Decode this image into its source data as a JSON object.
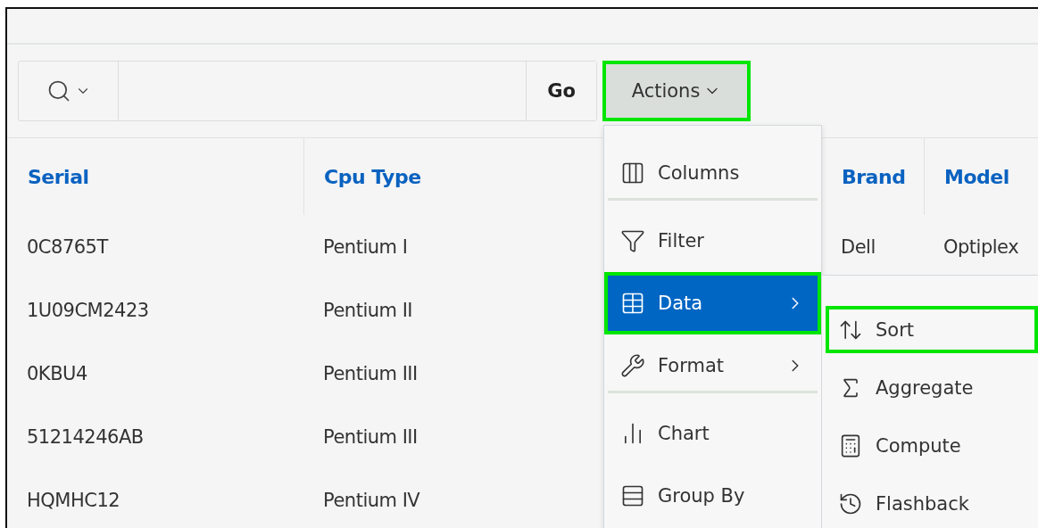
{
  "toolbar": {
    "go_button": "Go",
    "actions_button": {
      "label": "Actions",
      "highlighted": true
    }
  },
  "table": {
    "columns": [
      {
        "label": "Serial"
      },
      {
        "label": "Cpu Type"
      },
      {
        "label": "Brand"
      },
      {
        "label": "Model"
      }
    ],
    "rows": [
      {
        "serial": "0C8765T",
        "cpu_type": "Pentium I",
        "brand": "Dell",
        "model": "Optiplex"
      },
      {
        "serial": "1U09CM2423",
        "cpu_type": "Pentium II"
      },
      {
        "serial": "0KBU4",
        "cpu_type": "Pentium III"
      },
      {
        "serial": "51214246AB",
        "cpu_type": "Pentium III"
      },
      {
        "serial": "HQMHC12",
        "cpu_type": "Pentium IV"
      }
    ]
  },
  "actions_menu": {
    "items": [
      {
        "label": "Columns",
        "selected": false,
        "highlighted": false,
        "has_submenu": false,
        "group_end": true
      },
      {
        "label": "Filter",
        "selected": false,
        "highlighted": false,
        "has_submenu": false,
        "group_end": false
      },
      {
        "label": "Data",
        "selected": true,
        "highlighted": true,
        "has_submenu": true,
        "group_end": false
      },
      {
        "label": "Format",
        "selected": false,
        "highlighted": false,
        "has_submenu": true,
        "group_end": true
      },
      {
        "label": "Chart",
        "selected": false,
        "highlighted": false,
        "has_submenu": false,
        "group_end": false
      },
      {
        "label": "Group By",
        "selected": false,
        "highlighted": false,
        "has_submenu": false,
        "group_end": false
      }
    ]
  },
  "data_submenu": {
    "items": [
      {
        "label": "Sort",
        "highlighted": true
      },
      {
        "label": "Aggregate",
        "highlighted": false
      },
      {
        "label": "Compute",
        "highlighted": false
      },
      {
        "label": "Flashback",
        "highlighted": false
      }
    ]
  }
}
